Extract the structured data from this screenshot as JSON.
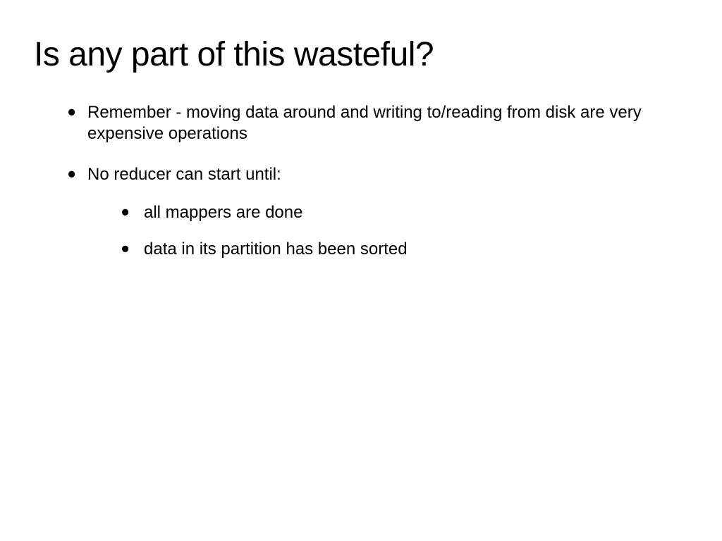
{
  "title": "Is any part of this wasteful?",
  "bullets": [
    {
      "text": "Remember - moving data around and writing to/reading from disk are very expensive operations"
    },
    {
      "text": "No reducer can start until:",
      "subbullets": [
        "all mappers are done",
        "data in its partition has been sorted"
      ]
    }
  ]
}
